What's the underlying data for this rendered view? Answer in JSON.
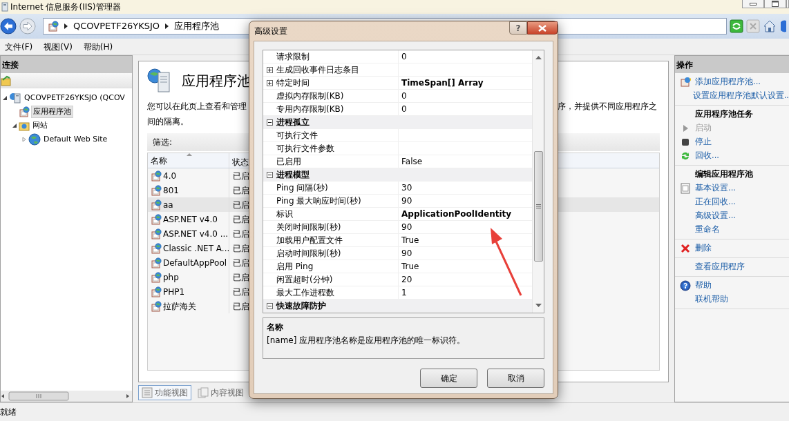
{
  "window": {
    "title": "Internet 信息服务(IIS)管理器"
  },
  "address": {
    "crumbs": [
      "QCOVPETF26YKSJO",
      "应用程序池"
    ]
  },
  "menu": [
    "文件(F)",
    "视图(V)",
    "帮助(H)"
  ],
  "connections": {
    "title": "连接",
    "tree": [
      {
        "label": "QCOVPETF26YKSJO (QCOV",
        "expanded": true,
        "selected": false,
        "children": [
          {
            "label": "应用程序池",
            "selected": true
          },
          {
            "label": "网站",
            "expanded": true,
            "selected": false,
            "children": [
              {
                "label": "Default Web Site",
                "expanded": false,
                "selected": false
              }
            ]
          }
        ]
      }
    ]
  },
  "page": {
    "title": "应用程序池",
    "description_left": "您可以在此页上查看和管理",
    "description_right": "序，并提供不同应用程序之",
    "description_line2": "间的隔离。",
    "filter_label": "筛选:",
    "columns": [
      "名称",
      "状态"
    ],
    "rows": [
      {
        "name": "4.0",
        "status": "已启",
        "selected": false
      },
      {
        "name": "801",
        "status": "已启",
        "selected": false
      },
      {
        "name": "aa",
        "status": "已启",
        "selected": true
      },
      {
        "name": "ASP.NET v4.0",
        "status": "已启",
        "selected": false
      },
      {
        "name": "ASP.NET v4.0 ...",
        "status": "已启",
        "selected": false
      },
      {
        "name": "Classic .NET A...",
        "status": "已启",
        "selected": false
      },
      {
        "name": "DefaultAppPool",
        "status": "已启",
        "selected": false
      },
      {
        "name": "php",
        "status": "已启",
        "selected": false
      },
      {
        "name": "PHP1",
        "status": "已启",
        "selected": false
      },
      {
        "name": "拉萨海关",
        "status": "已启",
        "selected": false
      }
    ],
    "views": [
      {
        "label": "功能视图",
        "selected": true
      },
      {
        "label": "内容视图",
        "selected": false
      }
    ]
  },
  "actions": {
    "title": "操作",
    "groups": [
      {
        "items": [
          {
            "label": "添加应用程序池...",
            "disabled": false
          },
          {
            "label": "设置应用程序池默认设置..",
            "disabled": false
          }
        ]
      },
      {
        "heading": "应用程序池任务",
        "items": [
          {
            "label": "启动",
            "disabled": true
          },
          {
            "label": "停止",
            "disabled": false
          },
          {
            "label": "回收...",
            "disabled": false
          }
        ]
      },
      {
        "heading": "编辑应用程序池",
        "items": [
          {
            "label": "基本设置...",
            "disabled": false
          },
          {
            "label": "正在回收...",
            "disabled": false
          },
          {
            "label": "高级设置...",
            "disabled": false
          },
          {
            "label": "重命名",
            "disabled": false
          }
        ]
      },
      {
        "items": [
          {
            "label": "删除",
            "disabled": false
          }
        ]
      },
      {
        "items": [
          {
            "label": "查看应用程序",
            "disabled": false
          }
        ]
      },
      {
        "items": [
          {
            "label": "帮助",
            "disabled": false
          },
          {
            "label": "联机帮助",
            "disabled": false
          }
        ]
      }
    ]
  },
  "dialog": {
    "title": "高级设置",
    "help_button": "?",
    "properties": [
      {
        "kind": "property",
        "name": "请求限制",
        "value": "0",
        "modified": false
      },
      {
        "kind": "property",
        "name": "生成回收事件日志条目",
        "expanded": false
      },
      {
        "kind": "property",
        "name": "特定时间",
        "value": "TimeSpan[] Array",
        "expanded": false,
        "modified": true
      },
      {
        "kind": "property",
        "name": "虚拟内存限制(KB)",
        "value": "0",
        "modified": false
      },
      {
        "kind": "property",
        "name": "专用内存限制(KB)",
        "value": "0",
        "modified": false
      },
      {
        "kind": "category",
        "name": "进程孤立",
        "expanded": true
      },
      {
        "kind": "property",
        "name": "可执行文件"
      },
      {
        "kind": "property",
        "name": "可执行文件参数"
      },
      {
        "kind": "property",
        "name": "已启用",
        "value": "False",
        "modified": false
      },
      {
        "kind": "category",
        "name": "进程模型",
        "expanded": true
      },
      {
        "kind": "property",
        "name": "Ping 间隔(秒)",
        "value": "30",
        "modified": false
      },
      {
        "kind": "property",
        "name": "Ping 最大响应时间(秒)",
        "value": "90",
        "modified": false
      },
      {
        "kind": "property",
        "name": "标识",
        "value": "ApplicationPoolIdentity",
        "modified": true
      },
      {
        "kind": "property",
        "name": "关闭时间限制(秒)",
        "value": "90",
        "modified": false
      },
      {
        "kind": "property",
        "name": "加载用户配置文件",
        "value": "True",
        "modified": false
      },
      {
        "kind": "property",
        "name": "启动时间限制(秒)",
        "value": "90",
        "modified": false
      },
      {
        "kind": "property",
        "name": "启用 Ping",
        "value": "True",
        "modified": false
      },
      {
        "kind": "property",
        "name": "闲置超时(分钟)",
        "value": "20",
        "modified": false
      },
      {
        "kind": "property",
        "name": "最大工作进程数",
        "value": "1",
        "modified": false
      },
      {
        "kind": "category",
        "name": "快速故障防护",
        "expanded": true
      }
    ],
    "description": {
      "title": "名称",
      "text": "[name] 应用程序池名称是应用程序池的唯一标识符。"
    },
    "buttons": [
      "确定",
      "取消"
    ]
  },
  "status_bar": "就绪"
}
